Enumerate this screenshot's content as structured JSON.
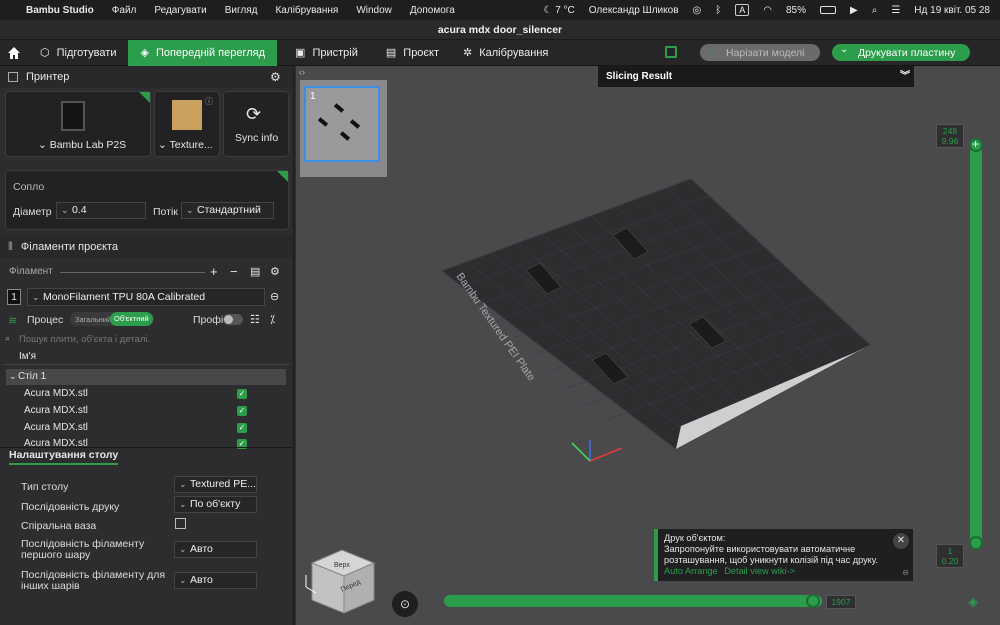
{
  "menubar": {
    "app": "Bambu Studio",
    "items": [
      "Файл",
      "Редагувати",
      "Вигляд",
      "Калібрування",
      "Window",
      "Допомога"
    ],
    "weather": "7 °C",
    "user": "Олександр Шликов",
    "input_lang": "A",
    "battery": "85%",
    "datetime": "Нд 19 квіт.  05 28"
  },
  "window_title": "acura mdx door_silencer",
  "toolbar": {
    "tabs": [
      "Підготувати",
      "Попередній перегляд",
      "Пристрій",
      "Проєкт",
      "Калібрування"
    ],
    "slice_label": "Нарізати моделі",
    "print_label": "Друкувати пластину"
  },
  "printer": {
    "section_label": "Принтер",
    "model": "Bambu Lab P2S",
    "plate": "Texture...",
    "sync_label": "Sync info"
  },
  "nozzle": {
    "label": "Сопло",
    "diameter_label": "Діаметр",
    "diameter_value": "0.4",
    "flow_label": "Потік",
    "flow_value": "Стандартний"
  },
  "filaments": {
    "section_label": "Філаменти проєкта",
    "sub_label": "Філамент",
    "slot": "1",
    "name": "MonoFilament TPU 80A Calibrated"
  },
  "process": {
    "label": "Процес",
    "toggle_global": "Загальний",
    "toggle_object": "Об'єктний",
    "advanced_label": "Профі",
    "search_placeholder": "Пошук плити, об'єкта і деталі.",
    "column_name": "Ім'я"
  },
  "tree": {
    "plate": "Стіл 1",
    "objects": [
      "Acura MDX.stl",
      "Acura MDX.stl",
      "Acura MDX.stl",
      "Acura MDX.stl"
    ]
  },
  "plate_settings": {
    "header": "Налаштування столу",
    "rows": [
      {
        "label": "Тип столу",
        "value": "Textured PE..."
      },
      {
        "label": "Послідовність друку",
        "value": "По об'єкту"
      },
      {
        "label": "Спіральна ваза",
        "value": ""
      },
      {
        "label": "Послідовність філаменту першого шару",
        "value": "Авто"
      },
      {
        "label": "Послідовність філаменту для інших шарів",
        "value": "Авто"
      }
    ]
  },
  "viewport": {
    "thumb_number": "1",
    "slicing_result": "Slicing Result",
    "layer_top": "248",
    "layer_top_height": "9.96",
    "layer_bottom": "1",
    "layer_bottom_height": "0.20",
    "horizontal_value": "1907",
    "bed_text": "Bambu Textured PEI Plate",
    "cube_top": "Верх",
    "cube_front": "Перед"
  },
  "notification": {
    "title": "Друк об'єктом:",
    "text": "Запропонуйте використовувати автоматичне розташування, щоб уникнути колізій під час друку.",
    "link1": "Auto Arrange",
    "link2": "Detail view wiki->"
  },
  "colors": {
    "accent": "#2c9d4b"
  }
}
